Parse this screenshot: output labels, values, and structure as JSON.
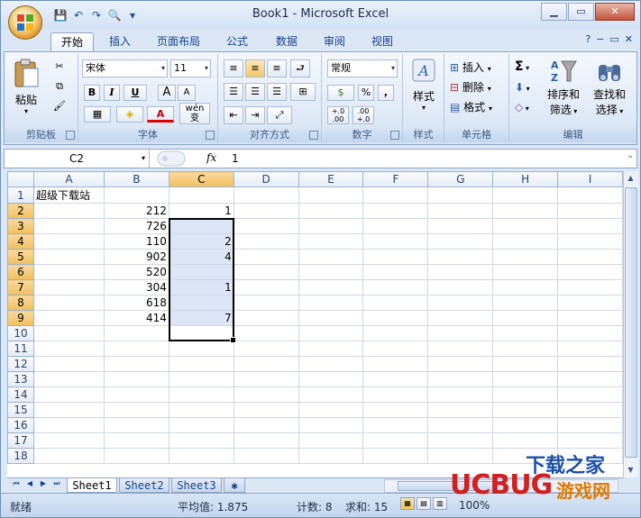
{
  "window": {
    "title": "Book1 - Microsoft Excel",
    "buttons": {
      "minimize": "▁",
      "restore": "▭",
      "close": "✕"
    }
  },
  "quick_access": {
    "save_icon": "💾",
    "undo_icon": "↶",
    "redo_icon": "↷",
    "preview_icon": "🔍",
    "customize_icon": "▾"
  },
  "tabs": [
    "开始",
    "插入",
    "页面布局",
    "公式",
    "数据",
    "审阅",
    "视图"
  ],
  "tabs_right": {
    "help": "?",
    "min": "−",
    "restore": "▭",
    "close": "✕"
  },
  "ribbon": {
    "clipboard": {
      "label": "剪贴板",
      "paste": "粘贴"
    },
    "font": {
      "label": "字体",
      "font_name": "宋体",
      "font_size": "11",
      "bold": "B",
      "italic": "I",
      "underline": "U",
      "grow": "A",
      "shrink": "A",
      "wen": "wén",
      "wen_char": "变",
      "font_color_letter": "A"
    },
    "alignment": {
      "label": "对齐方式"
    },
    "number": {
      "label": "数字",
      "format": "常规",
      "percent": "%",
      "comma": ",",
      "inc": "+.0",
      "inc2": ".00",
      "dec": ".00",
      "dec2": "+.0"
    },
    "styles": {
      "label": "样式",
      "button": "样式"
    },
    "cells": {
      "label": "单元格",
      "insert": "插入",
      "delete": "删除",
      "format": "格式"
    },
    "editing": {
      "label": "编辑",
      "sum": "Σ",
      "sort": "排序和\n筛选",
      "sort_l1": "排序和",
      "sort_l2": "筛选",
      "find_l1": "查找和",
      "find_l2": "选择"
    }
  },
  "formula_bar": {
    "name_box": "C2",
    "fx": "fx",
    "value": "1"
  },
  "sheet": {
    "columns": [
      "A",
      "B",
      "C",
      "D",
      "E",
      "F",
      "G",
      "H",
      "I"
    ],
    "rows": [
      {
        "n": "1",
        "A": "超级下载站",
        "B": "",
        "C": ""
      },
      {
        "n": "2",
        "A": "",
        "B": "212",
        "C": "1"
      },
      {
        "n": "3",
        "A": "",
        "B": "726",
        "C": ""
      },
      {
        "n": "4",
        "A": "",
        "B": "110",
        "C": "2"
      },
      {
        "n": "5",
        "A": "",
        "B": "902",
        "C": "4"
      },
      {
        "n": "6",
        "A": "",
        "B": "520",
        "C": ""
      },
      {
        "n": "7",
        "A": "",
        "B": "304",
        "C": "1"
      },
      {
        "n": "8",
        "A": "",
        "B": "618",
        "C": ""
      },
      {
        "n": "9",
        "A": "",
        "B": "414",
        "C": "7"
      },
      {
        "n": "10",
        "A": "",
        "B": "",
        "C": ""
      },
      {
        "n": "11",
        "A": "",
        "B": "",
        "C": ""
      },
      {
        "n": "12",
        "A": "",
        "B": "",
        "C": ""
      },
      {
        "n": "13",
        "A": "",
        "B": "",
        "C": ""
      },
      {
        "n": "14",
        "A": "",
        "B": "",
        "C": ""
      },
      {
        "n": "15",
        "A": "",
        "B": "",
        "C": ""
      },
      {
        "n": "16",
        "A": "",
        "B": "",
        "C": ""
      },
      {
        "n": "17",
        "A": "",
        "B": "",
        "C": ""
      },
      {
        "n": "18",
        "A": "",
        "B": "",
        "C": ""
      }
    ]
  },
  "sheet_tabs": [
    "Sheet1",
    "Sheet2",
    "Sheet3"
  ],
  "status": {
    "ready": "就绪",
    "average": "平均值: 1.875",
    "count": "计数: 8",
    "sum": "求和: 15",
    "zoom": "100%"
  },
  "watermark": {
    "brand": "UCBUG",
    "cn": "游戏网",
    "top": "下载之家",
    "sub": ".com"
  },
  "colors": {
    "accent": "#15428b",
    "selected_header": "#f1c05c",
    "selected_fill": "#dce6f4"
  }
}
